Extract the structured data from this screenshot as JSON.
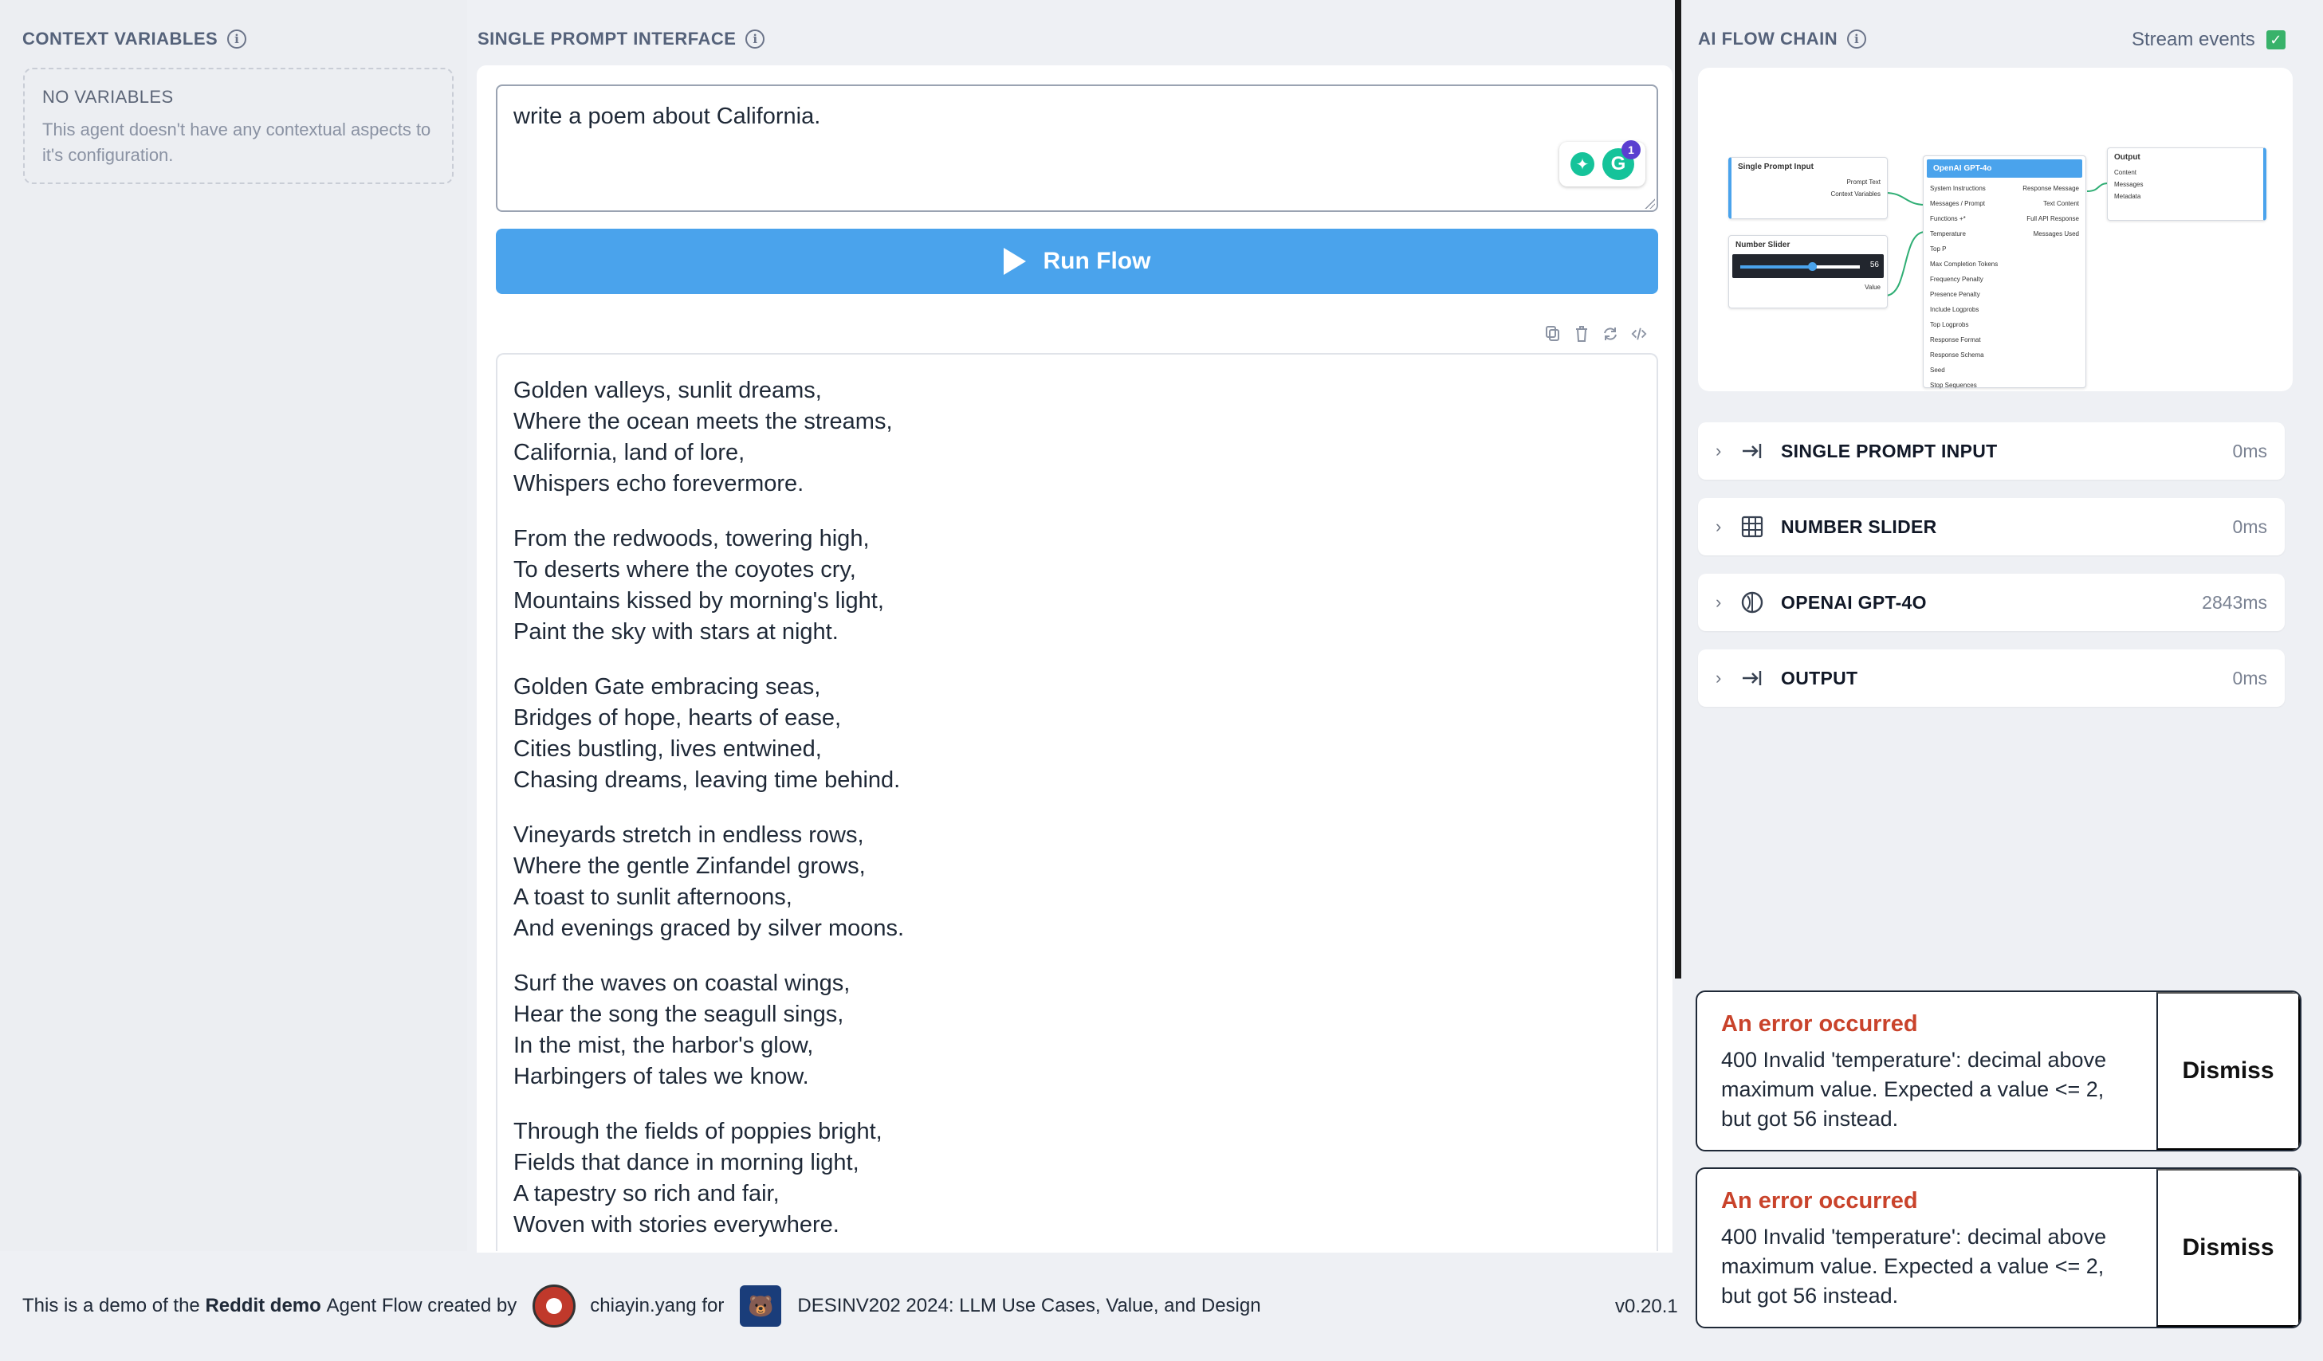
{
  "context": {
    "title": "CONTEXT VARIABLES",
    "empty_title": "NO VARIABLES",
    "empty_desc": "This agent doesn't have any contextual aspects to it's configuration."
  },
  "prompt": {
    "title": "SINGLE PROMPT INTERFACE",
    "value": "write a poem about California.",
    "grammarly_count": "1",
    "run_label": "Run Flow"
  },
  "output": {
    "stanzas": [
      [
        "Golden valleys, sunlit dreams,",
        "Where the ocean meets the streams,",
        "California, land of lore,",
        "Whispers echo forevermore."
      ],
      [
        "From the redwoods, towering high,",
        "To deserts where the coyotes cry,",
        "Mountains kissed by morning's light,",
        "Paint the sky with stars at night."
      ],
      [
        "Golden Gate embracing seas,",
        "Bridges of hope, hearts of ease,",
        "Cities bustling, lives entwined,",
        "Chasing dreams, leaving time behind."
      ],
      [
        "Vineyards stretch in endless rows,",
        "Where the gentle Zinfandel grows,",
        "A toast to sunlit afternoons,",
        "And evenings graced by silver moons."
      ],
      [
        "Surf the waves on coastal wings,",
        "Hear the song the seagull sings,",
        "In the mist, the harbor's glow,",
        "Harbingers of tales we know."
      ],
      [
        "Through the fields of poppies bright,",
        "Fields that dance in morning light,",
        "A tapestry so rich and fair,",
        "Woven with stories everywhere."
      ]
    ]
  },
  "chain": {
    "title": "AI FLOW CHAIN",
    "stream_label": "Stream events",
    "stream_checked": true,
    "items": [
      {
        "label": "SINGLE PROMPT INPUT",
        "time": "0ms",
        "icon": "input-arrow-icon"
      },
      {
        "label": "NUMBER SLIDER",
        "time": "0ms",
        "icon": "grid-icon"
      },
      {
        "label": "OPENAI GPT-4O",
        "time": "2843ms",
        "icon": "openai-icon"
      },
      {
        "label": "OUTPUT",
        "time": "0ms",
        "icon": "output-arrow-icon"
      }
    ],
    "canvas": {
      "spi_title": "Single Prompt Input",
      "spi_ports": [
        "Prompt Text",
        "Context Variables"
      ],
      "slider_title": "Number Slider",
      "slider_value": "56",
      "slider_port": "Value",
      "gpt_title": "OpenAI GPT-4o",
      "gpt_inputs": [
        "System Instructions",
        "Messages / Prompt",
        "Functions +*",
        "Temperature",
        "Top P",
        "Max Completion Tokens",
        "Frequency Penalty",
        "Presence Penalty",
        "Include Logprobs",
        "Top Logprobs",
        "Response Format",
        "Response Schema",
        "Seed",
        "Stop Sequences"
      ],
      "gpt_outputs": [
        "Response Message",
        "Text Content",
        "Full API Response",
        "Messages Used"
      ],
      "out_title": "Output",
      "out_ports": [
        "Content",
        "Messages",
        "Metadata"
      ]
    }
  },
  "errors": [
    {
      "title": "An error occurred",
      "message": "400 Invalid 'temperature': decimal above maximum value. Expected a value <= 2, but got 56 instead.",
      "button": "Dismiss"
    },
    {
      "title": "An error occurred",
      "message": "400 Invalid 'temperature': decimal above maximum value. Expected a value <= 2, but got 56 instead.",
      "button": "Dismiss"
    }
  ],
  "footer": {
    "prefix": "This is a demo of the",
    "flow_name": "Reddit demo",
    "middle": "Agent Flow created by",
    "author": "chiayin.yang for",
    "course": "DESINV202 2024: LLM Use Cases, Value, and Design",
    "version": "v0.20.1"
  }
}
